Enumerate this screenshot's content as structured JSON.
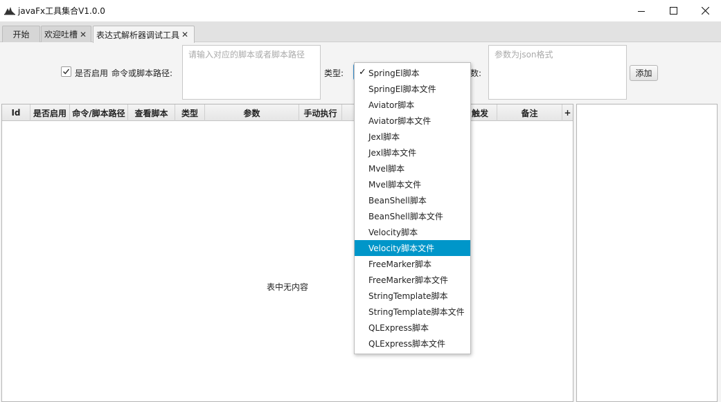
{
  "window": {
    "title": "javaFx工具集合V1.0.0",
    "controls": {
      "minimize": "minimize-icon",
      "maximize": "maximize-icon",
      "close": "close-icon"
    }
  },
  "tabs": [
    {
      "label": "开始",
      "closable": false
    },
    {
      "label": "欢迎吐槽",
      "closable": true
    },
    {
      "label": "表达式解析器调试工具",
      "closable": true,
      "active": true
    }
  ],
  "tab_close_glyph": "✕",
  "form": {
    "enable_label": "是否启用",
    "enable_checked": true,
    "path_label": "命令或脚本路径:",
    "path_placeholder": "请输入对应的脚本或者脚本路径",
    "type_label": "类型:",
    "params_label_tail": "数:",
    "params_placeholder": "参数为json格式",
    "add_button": "添加"
  },
  "table": {
    "columns": [
      "Id",
      "是否启用",
      "命令/脚本路径",
      "查看脚本",
      "类型",
      "参数",
      "手动执行",
      "",
      "触发",
      "备注",
      "+"
    ],
    "empty_text": "表中无内容"
  },
  "type_dropdown": {
    "selected": "SpringEl脚本",
    "highlighted": "Velocity脚本文件",
    "check_glyph": "✓",
    "options": [
      "SpringEl脚本",
      "SpringEl脚本文件",
      "Aviator脚本",
      "Aviator脚本文件",
      "Jexl脚本",
      "Jexl脚本文件",
      "Mvel脚本",
      "Mvel脚本文件",
      "BeanShell脚本",
      "BeanShell脚本文件",
      "Velocity脚本",
      "Velocity脚本文件",
      "FreeMarker脚本",
      "FreeMarker脚本文件",
      "StringTemplate脚本",
      "StringTemplate脚本文件",
      "QLExpress脚本",
      "QLExpress脚本文件"
    ]
  },
  "colors": {
    "accent": "#0096c9",
    "focus": "#3a94d4"
  }
}
